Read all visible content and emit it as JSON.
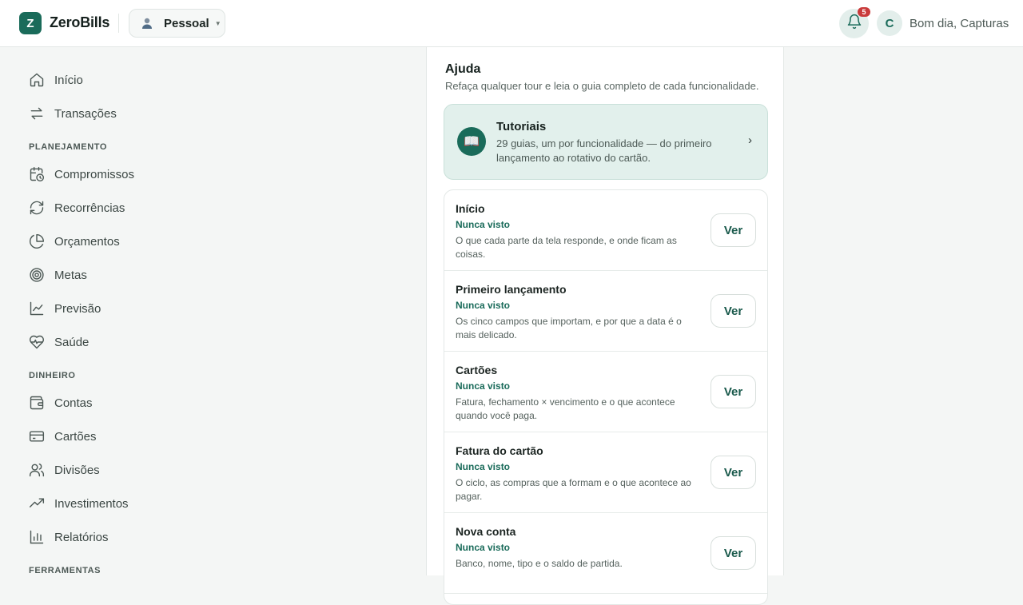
{
  "app": {
    "logo_letter": "Z",
    "name": "ZeroBills"
  },
  "profile": {
    "label": "Pessoal"
  },
  "header": {
    "notification_count": "5",
    "user_initial": "C",
    "greeting": "Bom dia, Capturas"
  },
  "sidebar": {
    "top_items": [
      {
        "label": "Início",
        "icon": "home-icon"
      },
      {
        "label": "Transações",
        "icon": "transfer-icon"
      }
    ],
    "sections": [
      {
        "title": "PLANEJAMENTO",
        "items": [
          {
            "label": "Compromissos",
            "icon": "calendar-clock-icon"
          },
          {
            "label": "Recorrências",
            "icon": "refresh-icon"
          },
          {
            "label": "Orçamentos",
            "icon": "pie-icon"
          },
          {
            "label": "Metas",
            "icon": "target-icon"
          },
          {
            "label": "Previsão",
            "icon": "line-chart-icon"
          },
          {
            "label": "Saúde",
            "icon": "heart-pulse-icon"
          }
        ]
      },
      {
        "title": "DINHEIRO",
        "items": [
          {
            "label": "Contas",
            "icon": "wallet-icon"
          },
          {
            "label": "Cartões",
            "icon": "credit-card-icon"
          },
          {
            "label": "Divisões",
            "icon": "users-icon"
          },
          {
            "label": "Investimentos",
            "icon": "trending-up-icon"
          },
          {
            "label": "Relatórios",
            "icon": "bar-chart-icon"
          }
        ]
      },
      {
        "title": "FERRAMENTAS",
        "items": []
      }
    ]
  },
  "help": {
    "title": "Ajuda",
    "subtitle": "Refaça qualquer tour e leia o guia completo de cada funcionalidade.",
    "tutorials": {
      "title": "Tutoriais",
      "description": "29 guias, um por funcionalidade — do primeiro lançamento ao rotativo do cartão."
    },
    "guides": [
      {
        "title": "Início",
        "status": "Nunca visto",
        "description": "O que cada parte da tela responde, e onde ficam as coisas.",
        "button": "Ver"
      },
      {
        "title": "Primeiro lançamento",
        "status": "Nunca visto",
        "description": "Os cinco campos que importam, e por que a data é o mais delicado.",
        "button": "Ver"
      },
      {
        "title": "Cartões",
        "status": "Nunca visto",
        "description": "Fatura, fechamento × vencimento e o que acontece quando você paga.",
        "button": "Ver"
      },
      {
        "title": "Fatura do cartão",
        "status": "Nunca visto",
        "description": "O ciclo, as compras que a formam e o que acontece ao pagar.",
        "button": "Ver"
      },
      {
        "title": "Nova conta",
        "status": "Nunca visto",
        "description": "Banco, nome, tipo e o saldo de partida.",
        "button": "Ver"
      }
    ]
  }
}
